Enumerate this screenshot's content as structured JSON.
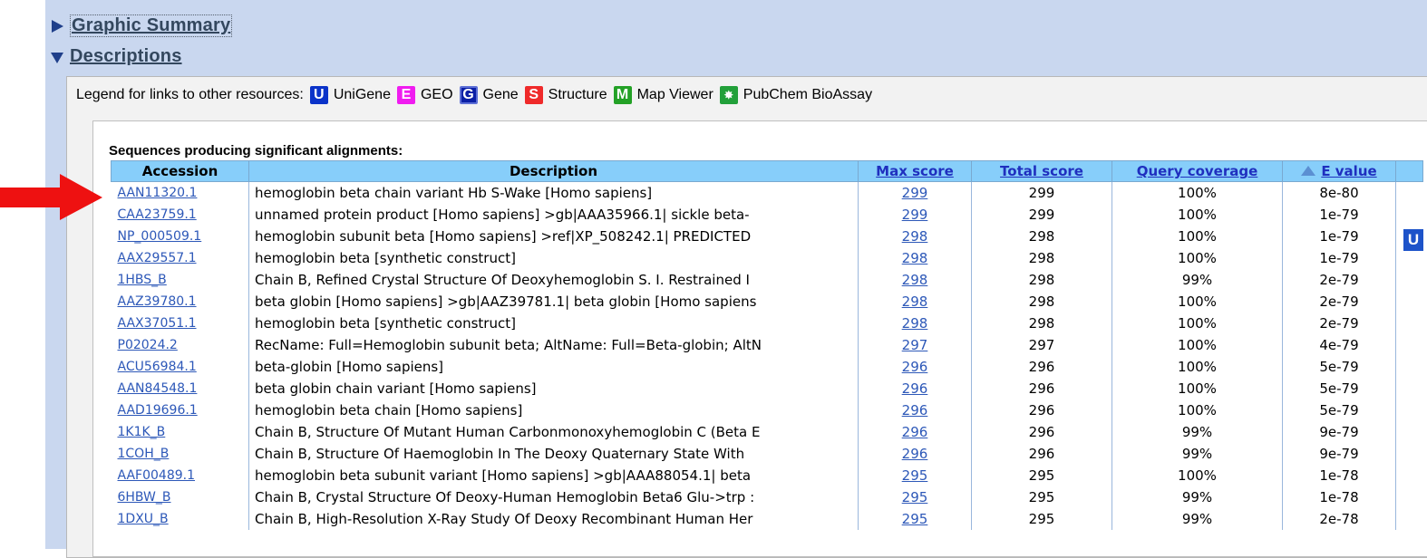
{
  "sections": {
    "graphic_summary": "Graphic Summary",
    "descriptions": "Descriptions"
  },
  "legend": {
    "label": "Legend for links to other resources:",
    "items": [
      {
        "icon_letter": "U",
        "icon": "unigene-icon",
        "label": "UniGene",
        "color": "#0b33c9"
      },
      {
        "icon_letter": "E",
        "icon": "geo-icon",
        "label": "GEO",
        "color": "#f01cf0"
      },
      {
        "icon_letter": "G",
        "icon": "gene-icon",
        "label": "Gene",
        "color": "#0b1fa6"
      },
      {
        "icon_letter": "S",
        "icon": "structure-icon",
        "label": "Structure",
        "color": "#ef2a2a"
      },
      {
        "icon_letter": "M",
        "icon": "map-viewer-icon",
        "label": "Map Viewer",
        "color": "#23a126"
      },
      {
        "icon_letter": "",
        "icon": "pubchem-bioassay-icon",
        "label": "PubChem BioAssay",
        "color": "#22a03a"
      }
    ]
  },
  "results": {
    "title": "Sequences producing significant alignments:",
    "columns": {
      "accession": "Accession",
      "description": "Description",
      "max_score": "Max score",
      "total_score": "Total score",
      "query_coverage": "Query coverage",
      "e_value": "E value"
    },
    "rows": [
      {
        "accession": "AAN11320.1",
        "description": "hemoglobin beta chain variant Hb S-Wake [Homo sapiens]",
        "max_score": "299",
        "total_score": "299",
        "coverage": "100%",
        "evalue": "8e-80"
      },
      {
        "accession": "CAA23759.1",
        "description": "unnamed protein product [Homo sapiens] >gb|AAA35966.1| sickle beta-",
        "max_score": "299",
        "total_score": "299",
        "coverage": "100%",
        "evalue": "1e-79"
      },
      {
        "accession": "NP_000509.1",
        "description": "hemoglobin subunit beta [Homo sapiens] >ref|XP_508242.1| PREDICTED",
        "max_score": "298",
        "total_score": "298",
        "coverage": "100%",
        "evalue": "1e-79"
      },
      {
        "accession": "AAX29557.1",
        "description": "hemoglobin beta [synthetic construct]",
        "max_score": "298",
        "total_score": "298",
        "coverage": "100%",
        "evalue": "1e-79"
      },
      {
        "accession": "1HBS_B",
        "description": "Chain B, Refined Crystal Structure Of Deoxyhemoglobin S. I. Restrained I",
        "max_score": "298",
        "total_score": "298",
        "coverage": "99%",
        "evalue": "2e-79"
      },
      {
        "accession": "AAZ39780.1",
        "description": "beta globin [Homo sapiens] >gb|AAZ39781.1| beta globin [Homo sapiens",
        "max_score": "298",
        "total_score": "298",
        "coverage": "100%",
        "evalue": "2e-79"
      },
      {
        "accession": "AAX37051.1",
        "description": "hemoglobin beta [synthetic construct]",
        "max_score": "298",
        "total_score": "298",
        "coverage": "100%",
        "evalue": "2e-79"
      },
      {
        "accession": "P02024.2",
        "description": "RecName: Full=Hemoglobin subunit beta; AltName: Full=Beta-globin; AltN",
        "max_score": "297",
        "total_score": "297",
        "coverage": "100%",
        "evalue": "4e-79"
      },
      {
        "accession": "ACU56984.1",
        "description": "beta-globin [Homo sapiens]",
        "max_score": "296",
        "total_score": "296",
        "coverage": "100%",
        "evalue": "5e-79"
      },
      {
        "accession": "AAN84548.1",
        "description": "beta globin chain variant [Homo sapiens]",
        "max_score": "296",
        "total_score": "296",
        "coverage": "100%",
        "evalue": "5e-79"
      },
      {
        "accession": "AAD19696.1",
        "description": "hemoglobin beta chain [Homo sapiens]",
        "max_score": "296",
        "total_score": "296",
        "coverage": "100%",
        "evalue": "5e-79"
      },
      {
        "accession": "1K1K_B",
        "description": "Chain B, Structure Of Mutant Human Carbonmonoxyhemoglobin C (Beta E",
        "max_score": "296",
        "total_score": "296",
        "coverage": "99%",
        "evalue": "9e-79"
      },
      {
        "accession": "1COH_B",
        "description": "Chain B, Structure Of Haemoglobin In The Deoxy Quaternary State With",
        "max_score": "296",
        "total_score": "296",
        "coverage": "99%",
        "evalue": "9e-79"
      },
      {
        "accession": "AAF00489.1",
        "description": "hemoglobin beta subunit variant [Homo sapiens] >gb|AAA88054.1| beta",
        "max_score": "295",
        "total_score": "295",
        "coverage": "100%",
        "evalue": "1e-78"
      },
      {
        "accession": "6HBW_B",
        "description": "Chain B, Crystal Structure Of Deoxy-Human Hemoglobin Beta6 Glu->trp :",
        "max_score": "295",
        "total_score": "295",
        "coverage": "99%",
        "evalue": "1e-78"
      },
      {
        "accession": "1DXU_B",
        "description": "Chain B, High-Resolution X-Ray Study Of Deoxy Recombinant Human Her",
        "max_score": "295",
        "total_score": "295",
        "coverage": "99%",
        "evalue": "2e-78"
      }
    ],
    "side_badge": "U"
  },
  "annotation": {
    "arrow_color": "#ee1111"
  }
}
